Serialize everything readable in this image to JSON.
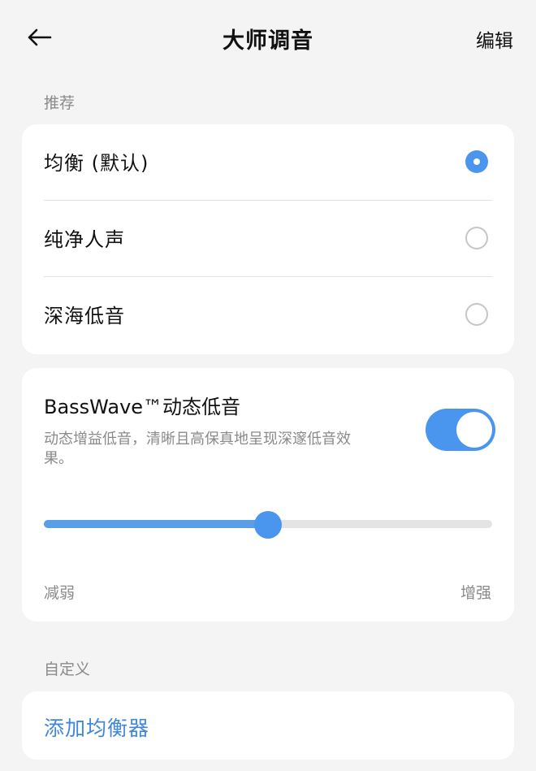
{
  "header": {
    "title": "大师调音",
    "back_icon": "arrow-left-icon",
    "edit_label": "编辑"
  },
  "recommended": {
    "section_label": "推荐",
    "presets": [
      {
        "label": "均衡 (默认)",
        "selected": true
      },
      {
        "label": "纯净人声",
        "selected": false
      },
      {
        "label": "深海低音",
        "selected": false
      }
    ]
  },
  "basswave": {
    "title": "BassWave™动态低音",
    "description": "动态增益低音，清晰且高保真地呈现深邃低音效果。",
    "enabled": true,
    "level": 0.5,
    "min_label": "减弱",
    "max_label": "增强"
  },
  "custom": {
    "section_label": "自定义",
    "add_label": "添加均衡器"
  },
  "colors": {
    "accent": "#4a95ee",
    "link": "#3f86dd",
    "background": "#f4f4f4"
  }
}
